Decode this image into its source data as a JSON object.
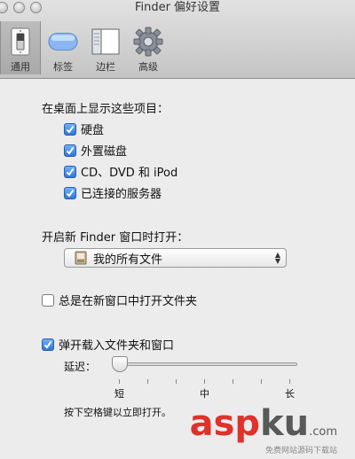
{
  "window": {
    "title": "Finder 偏好设置"
  },
  "toolbar": {
    "items": [
      {
        "label": "通用",
        "icon": "light-switch-icon",
        "selected": true
      },
      {
        "label": "标签",
        "icon": "tag-icon",
        "selected": false
      },
      {
        "label": "边栏",
        "icon": "sidebar-icon",
        "selected": false
      },
      {
        "label": "高级",
        "icon": "gear-icon",
        "selected": false
      }
    ]
  },
  "desktop": {
    "heading": "在桌面上显示这些项目：",
    "items": [
      {
        "label": "硬盘",
        "checked": true
      },
      {
        "label": "外置磁盘",
        "checked": true
      },
      {
        "label": "CD、DVD 和 iPod",
        "checked": true
      },
      {
        "label": "已连接的服务器",
        "checked": true
      }
    ]
  },
  "new_window": {
    "heading": "开启新 Finder 窗口时打开：",
    "selected_value": "我的所有文件"
  },
  "open_folders_in_new_window": {
    "label": "总是在新窗口中打开文件夹",
    "checked": false
  },
  "spring_loaded": {
    "label": "弹开载入文件夹和窗口",
    "checked": true,
    "delay_label": "延迟：",
    "delay_value": 0.0,
    "tick_labels": [
      "短",
      "中",
      "长"
    ],
    "hint": "按下空格键以立即打开。"
  },
  "watermark": {
    "main_red": "asp",
    "main_gray": "ku",
    "suffix": ".com",
    "sub": "免费网站源码下载站"
  },
  "colors": {
    "accent": "#2f77d9",
    "watermark_red": "#e0312b"
  }
}
